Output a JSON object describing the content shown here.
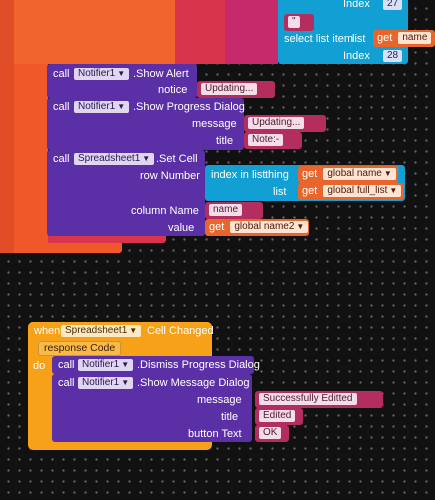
{
  "top": {
    "index1_label": "Index",
    "index1_value": "27",
    "string_quote": "\"",
    "select_label": "select list item",
    "list_label": "list",
    "get_label": "get",
    "get_var": "name",
    "index2_label": "Index",
    "index2_value": "28"
  },
  "show_alert": {
    "call": "call",
    "component": "Notifier1",
    "method": ".Show Alert",
    "notice_label": "notice",
    "notice_value": "Updating..."
  },
  "progress": {
    "call": "call",
    "component": "Notifier1",
    "method": ".Show Progress Dialog",
    "message_label": "message",
    "message_value": "Updating...",
    "title_label": "title",
    "title_value": "Note:-"
  },
  "set_cell": {
    "call": "call",
    "component": "Spreadsheet1",
    "method": ".Set Cell",
    "row_label": "row Number",
    "index_in_list": "index in list",
    "thing_label": "thing",
    "thing_get": "get",
    "thing_var": "global name",
    "list_label": "list",
    "list_get": "get",
    "list_var": "global full_list",
    "column_label": "column Name",
    "column_value": "name",
    "value_label": "value",
    "value_get": "get",
    "value_var": "global name2"
  },
  "event": {
    "when": "when",
    "component": "Spreadsheet1",
    "event_name": "Cell Changed",
    "param": "response Code",
    "do": "do",
    "dismiss_call": "call",
    "dismiss_component": "Notifier1",
    "dismiss_method": ".Dismiss Progress Dialog",
    "msg_call": "call",
    "msg_component": "Notifier1",
    "msg_method": ".Show Message Dialog",
    "message_label": "message",
    "message_value": "Successfully Editted",
    "title_label": "title",
    "title_value": "Edited",
    "button_label": "button Text",
    "button_value": "OK"
  },
  "colors": {
    "control_orange": "#f0582a",
    "control_red": "#d8344c",
    "list_cyan": "#129fd3",
    "component_purple": "#5b30a6",
    "text_pink": "#b32d5e",
    "variable_orange": "#e8662b",
    "event_yellow": "#f6a118"
  }
}
